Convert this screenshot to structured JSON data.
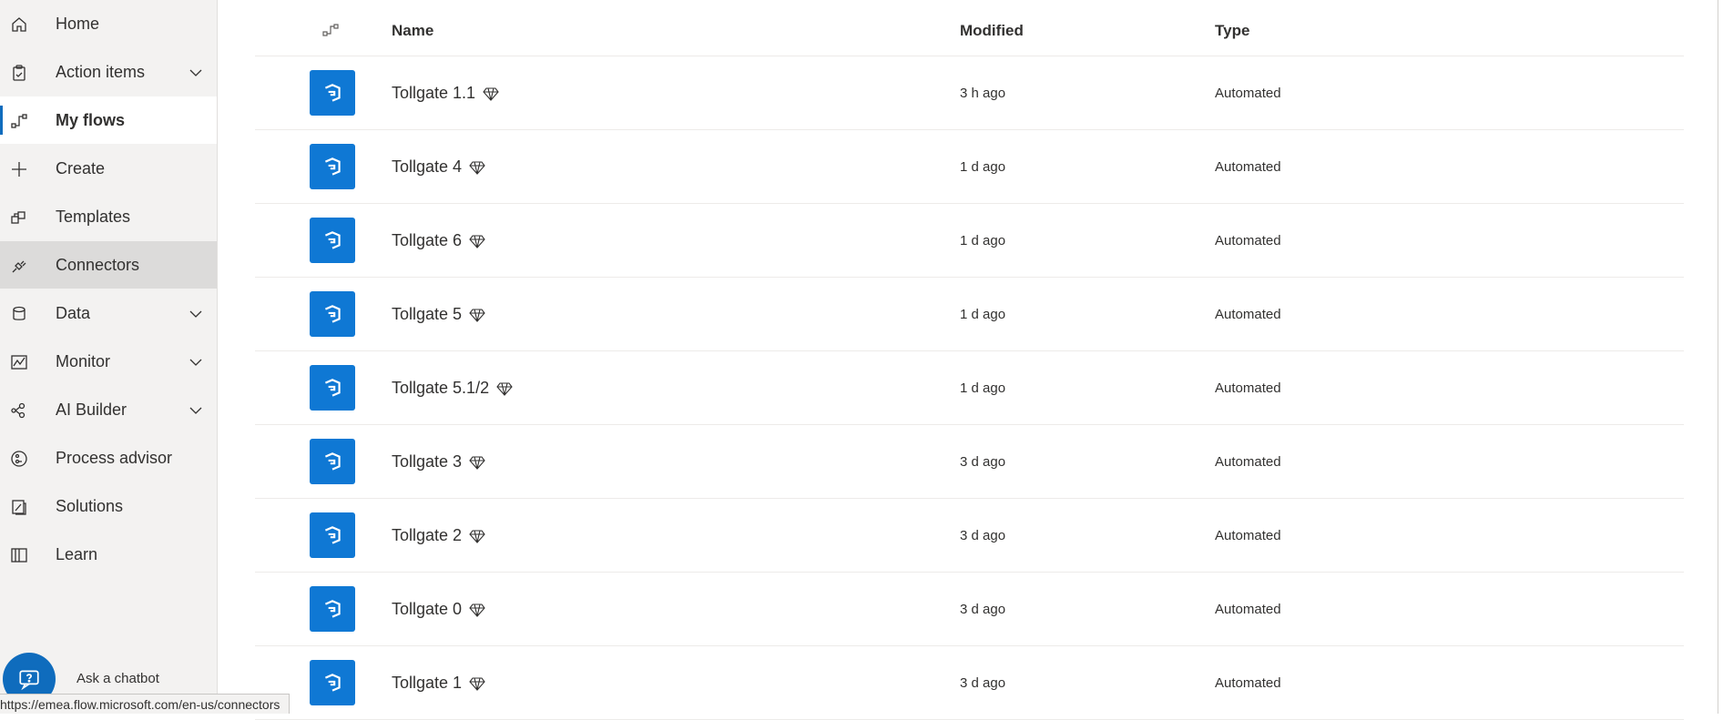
{
  "sidebar": {
    "items": [
      {
        "label": "Home",
        "icon": "home-icon"
      },
      {
        "label": "Action items",
        "icon": "clipboard-icon",
        "expandable": true
      },
      {
        "label": "My flows",
        "icon": "flow-icon",
        "active": true
      },
      {
        "label": "Create",
        "icon": "plus-icon"
      },
      {
        "label": "Templates",
        "icon": "templates-icon"
      },
      {
        "label": "Connectors",
        "icon": "plug-icon",
        "hovered": true
      },
      {
        "label": "Data",
        "icon": "database-icon",
        "expandable": true
      },
      {
        "label": "Monitor",
        "icon": "chart-icon",
        "expandable": true
      },
      {
        "label": "AI Builder",
        "icon": "ai-builder-icon",
        "expandable": true
      },
      {
        "label": "Process advisor",
        "icon": "process-advisor-icon"
      },
      {
        "label": "Solutions",
        "icon": "solutions-icon"
      },
      {
        "label": "Learn",
        "icon": "book-icon"
      }
    ],
    "chatbot_label": "Ask a chatbot"
  },
  "status_url": "https://emea.flow.microsoft.com/en-us/connectors",
  "table": {
    "columns": {
      "name": "Name",
      "modified": "Modified",
      "type": "Type"
    },
    "rows": [
      {
        "name": "Tollgate 1.1",
        "modified": "3 h ago",
        "type": "Automated"
      },
      {
        "name": "Tollgate 4",
        "modified": "1 d ago",
        "type": "Automated"
      },
      {
        "name": "Tollgate 6",
        "modified": "1 d ago",
        "type": "Automated"
      },
      {
        "name": "Tollgate 5",
        "modified": "1 d ago",
        "type": "Automated"
      },
      {
        "name": "Tollgate 5.1/2",
        "modified": "1 d ago",
        "type": "Automated"
      },
      {
        "name": "Tollgate 3",
        "modified": "3 d ago",
        "type": "Automated"
      },
      {
        "name": "Tollgate 2",
        "modified": "3 d ago",
        "type": "Automated"
      },
      {
        "name": "Tollgate 0",
        "modified": "3 d ago",
        "type": "Automated"
      },
      {
        "name": "Tollgate 1",
        "modified": "3 d ago",
        "type": "Automated"
      }
    ]
  },
  "colors": {
    "accent": "#0f78d4",
    "sidebar_bg": "#f3f2f1",
    "active_bar": "#0f6cbd"
  }
}
